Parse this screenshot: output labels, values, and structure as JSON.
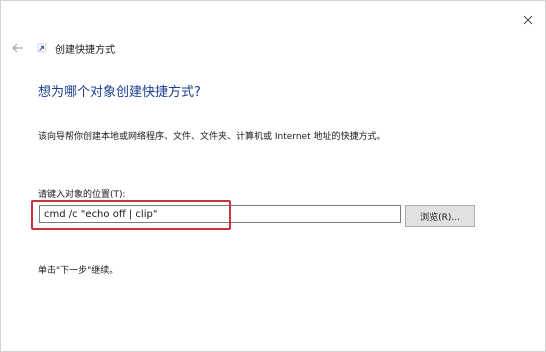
{
  "window": {
    "title": "创建快捷方式",
    "close_icon": "close-icon",
    "back_icon": "back-arrow-icon",
    "shortcut_icon": "shortcut-icon"
  },
  "wizard": {
    "heading": "想为哪个对象创建快捷方式?",
    "description": "该向导帮你创建本地或网络程序、文件、文件夹、计算机或 Internet 地址的快捷方式。",
    "location_label": "请键入对象的位置(T):",
    "location_value": "cmd /c \"echo off | clip\"",
    "browse_label": "浏览(R)...",
    "next_hint": "单击\"下一步\"继续。"
  },
  "colors": {
    "heading": "#1c3f94",
    "highlight": "#c8353a"
  }
}
